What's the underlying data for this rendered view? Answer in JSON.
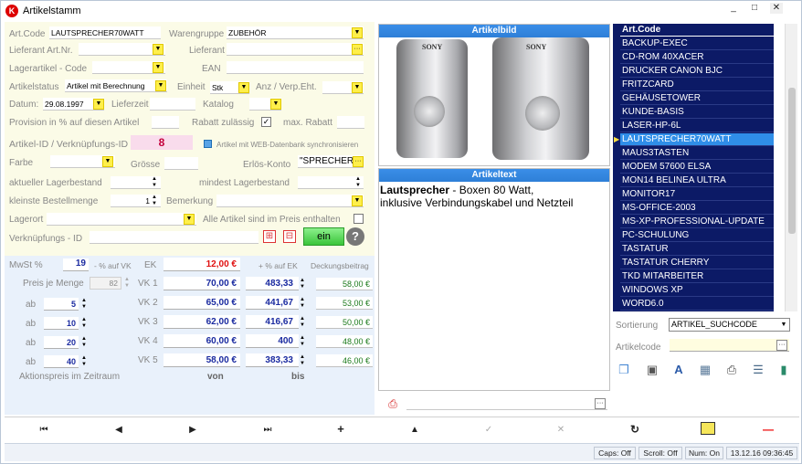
{
  "window": {
    "title": "Artikelstamm",
    "app_icon": "K",
    "controls": [
      "_",
      "□",
      "✕"
    ]
  },
  "form": {
    "art_code_label": "Art.Code",
    "art_code_value": "LAUTSPRECHER70WATT",
    "warengruppe_label": "Warengruppe",
    "warengruppe_value": "ZUBEHÖR",
    "lieferant_artnr_label": "Lieferant Art.Nr.",
    "lieferant_label": "Lieferant",
    "lagerartikel_label": "Lagerartikel - Code",
    "ean_label": "EAN",
    "artikelstatus_label": "Artikelstatus",
    "artikelstatus_value": "Artikel mit Berechnung",
    "einheit_label": "Einheit",
    "einheit_value": "Stk",
    "anz_label": "Anz / Verp.Eht.",
    "datum_label": "Datum:",
    "datum_value": "29.08.1997",
    "lieferzeit_label": "Lieferzeit",
    "katalog_label": "Katalog",
    "provision_label": "Provision in % auf diesen Artikel",
    "rabatt_label": "Rabatt zulässig",
    "rabatt_checked": "✓",
    "max_rabatt_label": "max. Rabatt",
    "artikel_id_label": "Artikel-ID / Verknüpfungs-ID",
    "artikel_id_value": "8",
    "web_sync_label": "Artikel mit WEB-Datenbank synchronisieren",
    "farbe_label": "Farbe",
    "groesse_label": "Grösse",
    "erloes_label": "Erlös-Konto",
    "erloes_value": "\"SPRECHER",
    "akt_lager_label": "aktueller Lagerbestand",
    "mindest_lager_label": "mindest Lagerbestand",
    "kleinste_label": "kleinste Bestellmenge",
    "kleinste_value": "1",
    "bemerkung_label": "Bemerkung",
    "lagerort_label": "Lagerort",
    "alle_artikel_label": "Alle Artikel sind im Preis enthalten",
    "verknuepfungs_label": "Verknüpfungs - ID",
    "ein_button": "ein",
    "help_glyph": "?"
  },
  "prices": {
    "mwst_label": "MwSt %",
    "mwst_value": "19",
    "pct_auf_vk": "- % auf VK",
    "ek_label": "EK",
    "ek_value": "12,00 €",
    "plus_pct_ek": "+ % auf EK",
    "deckung_label": "Deckungsbeitrag",
    "preis_je_menge_label": "Preis je Menge",
    "preis_je_menge_value": "82",
    "ab_label": "ab",
    "von_label": "von",
    "bis_label": "bis",
    "aktion_label": "Aktionspreis im Zeitraum",
    "rows": [
      {
        "ab": "",
        "vk": "VK 1",
        "price": "70,00 €",
        "pct": "483,33",
        "deckung": "58,00 €"
      },
      {
        "ab": "5",
        "vk": "VK 2",
        "price": "65,00 €",
        "pct": "441,67",
        "deckung": "53,00 €"
      },
      {
        "ab": "10",
        "vk": "VK 3",
        "price": "62,00 €",
        "pct": "416,67",
        "deckung": "50,00 €"
      },
      {
        "ab": "20",
        "vk": "VK 4",
        "price": "60,00 €",
        "pct": "400",
        "deckung": "48,00 €"
      },
      {
        "ab": "40",
        "vk": "VK 5",
        "price": "58,00 €",
        "pct": "383,33",
        "deckung": "46,00 €"
      }
    ]
  },
  "image_panel": {
    "header": "Artikelbild",
    "brand": "SONY"
  },
  "text_panel": {
    "header": "Artikeltext",
    "bold": "Lautsprecher",
    "line1": " - Boxen 80 Watt,",
    "line2": "inklusive Verbindungskabel und Netzteil"
  },
  "list": {
    "header": "Art.Code",
    "items": [
      "BACKUP-EXEC",
      "CD-ROM 40XACER",
      "DRUCKER CANON BJC",
      "FRITZCARD",
      "GEHÄUSETOWER",
      "KUNDE-BASIS",
      "LASER-HP-6L",
      "LAUTSPRECHER70WATT",
      "MAUS3TASTEN",
      "MODEM 57600 ELSA",
      "MON14 BELINEA ULTRA",
      "MONITOR17",
      "MS-OFFICE-2003",
      "MS-XP-PROFESSIONAL-UPDATE",
      "PC-SCHULUNG",
      "TASTATUR",
      "TASTATUR CHERRY",
      "TKD MITARBEITER",
      "WINDOWS XP",
      "WORD6.0"
    ],
    "selected_index": 7
  },
  "search": {
    "sortierung_label": "Sortierung",
    "sortierung_value": "ARTIKEL_SUCHCODE",
    "artikelcode_label": "Artikelcode"
  },
  "nav": {
    "first": "⏮",
    "prev": "◀",
    "next": "▶",
    "last": "⏭",
    "add": "+",
    "up": "▲",
    "check": "✓",
    "cancel": "✕",
    "refresh": "↻",
    "minus": "—"
  },
  "status": {
    "caps": "Caps: Off",
    "scroll": "Scroll: Off",
    "num": "Num: On",
    "datetime": "13.12.16 09:36:45"
  }
}
